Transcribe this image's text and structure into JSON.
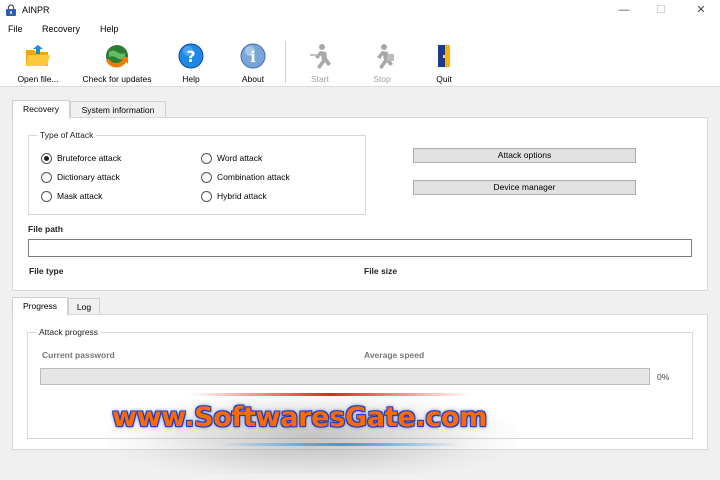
{
  "window": {
    "title": "AINPR",
    "minimize": "—",
    "maximize": "☐",
    "close": "✕"
  },
  "menu": {
    "file": "File",
    "recovery": "Recovery",
    "help": "Help"
  },
  "toolbar": {
    "open": "Open file...",
    "updates": "Check for updates",
    "help": "Help",
    "about": "About",
    "start": "Start",
    "stop": "Stop",
    "quit": "Quit"
  },
  "tabs_top": {
    "recovery": "Recovery",
    "system_info": "System information"
  },
  "attack_group": {
    "title": "Type of Attack",
    "options": [
      "Bruteforce attack",
      "Word attack",
      "Dictionary attack",
      "Combination attack",
      "Mask attack",
      "Hybrid attack"
    ],
    "selected": "Bruteforce attack"
  },
  "buttons": {
    "attack_options": "Attack options",
    "device_manager": "Device manager"
  },
  "file": {
    "path_label": "File path",
    "path_value": "",
    "type_label": "File type",
    "size_label": "File size"
  },
  "tabs_bottom": {
    "progress": "Progress",
    "log": "Log"
  },
  "progress_group": {
    "title": "Attack progress",
    "current_password_label": "Current password",
    "average_speed_label": "Average speed",
    "percent_text": "0%",
    "percent": 0
  },
  "watermark": {
    "text": "www.SoftwaresGate.com"
  },
  "icons": {
    "app": "lock-icon",
    "open": "folder-open-icon",
    "updates": "globe-refresh-icon",
    "help": "help-icon",
    "about": "info-icon",
    "start": "run-icon",
    "stop": "stop-run-icon",
    "quit": "exit-door-icon"
  },
  "colors": {
    "accent_blue": "#1e88e5",
    "progress_fill": "#06b025",
    "watermark_orange": "#ff6a00",
    "watermark_blue": "#1a3cc4"
  }
}
